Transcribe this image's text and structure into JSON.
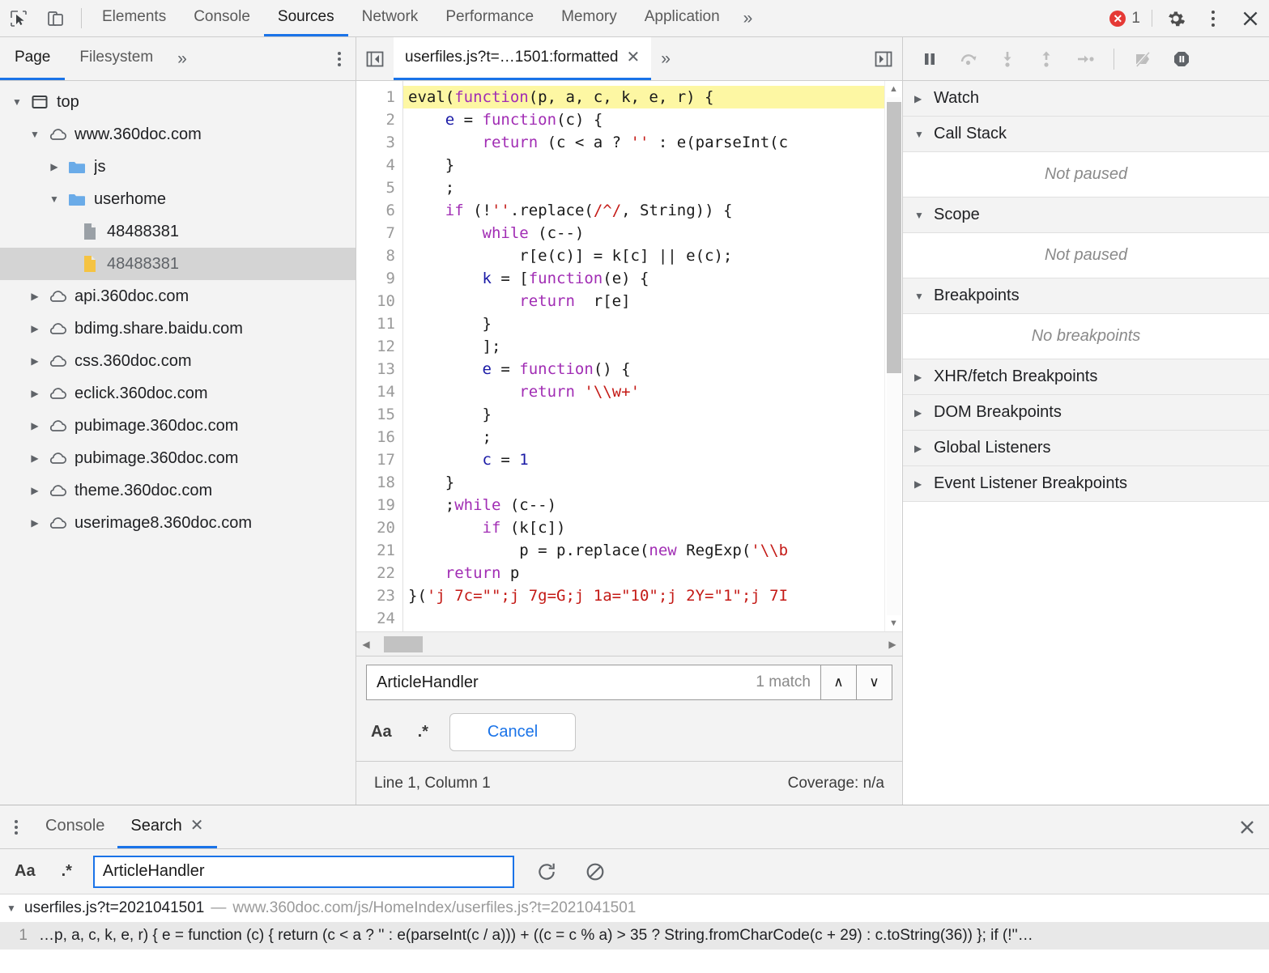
{
  "toolbar": {
    "inspect_icon": "inspect-cursor-icon",
    "device_icon": "device-toolbar-icon",
    "tabs": [
      {
        "label": "Elements",
        "active": false
      },
      {
        "label": "Console",
        "active": false
      },
      {
        "label": "Sources",
        "active": true
      },
      {
        "label": "Network",
        "active": false
      },
      {
        "label": "Performance",
        "active": false
      },
      {
        "label": "Memory",
        "active": false
      },
      {
        "label": "Application",
        "active": false
      }
    ],
    "overflow": "»",
    "error_count": "1",
    "error_glyph": "✕",
    "settings_icon": "gear-icon",
    "menu_icon": "kebab-menu-icon",
    "close_icon": "close-icon"
  },
  "navigator": {
    "tabs": [
      {
        "label": "Page",
        "active": true
      },
      {
        "label": "Filesystem",
        "active": false
      }
    ],
    "overflow": "»",
    "tree": [
      {
        "label": "top",
        "indent": 0,
        "twisty": "down",
        "icon": "frame-icon",
        "selected": false
      },
      {
        "label": "www.360doc.com",
        "indent": 1,
        "twisty": "down",
        "icon": "cloud-icon",
        "selected": false
      },
      {
        "label": "js",
        "indent": 2,
        "twisty": "right",
        "icon": "folder-icon",
        "selected": false
      },
      {
        "label": "userhome",
        "indent": 2,
        "twisty": "down",
        "icon": "folder-icon",
        "selected": false
      },
      {
        "label": "48488381",
        "indent": 3,
        "twisty": "none",
        "icon": "file-gray-icon",
        "selected": false
      },
      {
        "label": "48488381",
        "indent": 3,
        "twisty": "none",
        "icon": "file-yellow-icon",
        "selected": true
      },
      {
        "label": "api.360doc.com",
        "indent": 1,
        "twisty": "right",
        "icon": "cloud-icon",
        "selected": false
      },
      {
        "label": "bdimg.share.baidu.com",
        "indent": 1,
        "twisty": "right",
        "icon": "cloud-icon",
        "selected": false
      },
      {
        "label": "css.360doc.com",
        "indent": 1,
        "twisty": "right",
        "icon": "cloud-icon",
        "selected": false
      },
      {
        "label": "eclick.360doc.com",
        "indent": 1,
        "twisty": "right",
        "icon": "cloud-icon",
        "selected": false
      },
      {
        "label": "pubimage.360doc.com",
        "indent": 1,
        "twisty": "right",
        "icon": "cloud-icon",
        "selected": false
      },
      {
        "label": "pubimage.360doc.com",
        "indent": 1,
        "twisty": "right",
        "icon": "cloud-icon",
        "selected": false
      },
      {
        "label": "theme.360doc.com",
        "indent": 1,
        "twisty": "right",
        "icon": "cloud-icon",
        "selected": false
      },
      {
        "label": "userimage8.360doc.com",
        "indent": 1,
        "twisty": "right",
        "icon": "cloud-icon",
        "selected": false
      }
    ]
  },
  "editor": {
    "nav_back_icon": "panel-collapse-left-icon",
    "nav_forward_icon": "panel-collapse-right-icon",
    "tab_title": "userfiles.js?t=…1501:formatted",
    "tab_close": "✕",
    "tab_overflow": "»",
    "lines": [
      {
        "n": "1",
        "highlight": true,
        "tokens": [
          {
            "t": "eval(",
            "c": "p"
          },
          {
            "t": "function",
            "c": "k"
          },
          {
            "t": "(p, a, c, k, e, r) {",
            "c": "p"
          }
        ]
      },
      {
        "n": "2",
        "highlight": false,
        "tokens": [
          {
            "t": "    ",
            "c": "p"
          },
          {
            "t": "e",
            "c": "v"
          },
          {
            "t": " = ",
            "c": "p"
          },
          {
            "t": "function",
            "c": "k"
          },
          {
            "t": "(c) {",
            "c": "p"
          }
        ]
      },
      {
        "n": "3",
        "highlight": false,
        "tokens": [
          {
            "t": "        ",
            "c": "p"
          },
          {
            "t": "return",
            "c": "k"
          },
          {
            "t": " (c < a ? ",
            "c": "p"
          },
          {
            "t": "''",
            "c": "s"
          },
          {
            "t": " : e(parseInt(c",
            "c": "p"
          }
        ]
      },
      {
        "n": "4",
        "highlight": false,
        "tokens": [
          {
            "t": "    }",
            "c": "p"
          }
        ]
      },
      {
        "n": "5",
        "highlight": false,
        "tokens": [
          {
            "t": "    ;",
            "c": "p"
          }
        ]
      },
      {
        "n": "6",
        "highlight": false,
        "tokens": [
          {
            "t": "    ",
            "c": "p"
          },
          {
            "t": "if",
            "c": "k"
          },
          {
            "t": " (!",
            "c": "p"
          },
          {
            "t": "''",
            "c": "s"
          },
          {
            "t": ".replace(",
            "c": "p"
          },
          {
            "t": "/^/",
            "c": "s"
          },
          {
            "t": ", String)) {",
            "c": "p"
          }
        ]
      },
      {
        "n": "7",
        "highlight": false,
        "tokens": [
          {
            "t": "        ",
            "c": "p"
          },
          {
            "t": "while",
            "c": "k"
          },
          {
            "t": " (c--)",
            "c": "p"
          }
        ]
      },
      {
        "n": "8",
        "highlight": false,
        "tokens": [
          {
            "t": "            r[e(c)] = k[c] || e(c);",
            "c": "p"
          }
        ]
      },
      {
        "n": "9",
        "highlight": false,
        "tokens": [
          {
            "t": "        ",
            "c": "p"
          },
          {
            "t": "k",
            "c": "v"
          },
          {
            "t": " = [",
            "c": "p"
          },
          {
            "t": "function",
            "c": "k"
          },
          {
            "t": "(e) {",
            "c": "p"
          }
        ]
      },
      {
        "n": "10",
        "highlight": false,
        "tokens": [
          {
            "t": "            ",
            "c": "p"
          },
          {
            "t": "return",
            "c": "k"
          },
          {
            "t": "  r[e]",
            "c": "p"
          }
        ]
      },
      {
        "n": "11",
        "highlight": false,
        "tokens": [
          {
            "t": "        }",
            "c": "p"
          }
        ]
      },
      {
        "n": "12",
        "highlight": false,
        "tokens": [
          {
            "t": "        ];",
            "c": "p"
          }
        ]
      },
      {
        "n": "13",
        "highlight": false,
        "tokens": [
          {
            "t": "        ",
            "c": "p"
          },
          {
            "t": "e",
            "c": "v"
          },
          {
            "t": " = ",
            "c": "p"
          },
          {
            "t": "function",
            "c": "k"
          },
          {
            "t": "() {",
            "c": "p"
          }
        ]
      },
      {
        "n": "14",
        "highlight": false,
        "tokens": [
          {
            "t": "            ",
            "c": "p"
          },
          {
            "t": "return",
            "c": "k"
          },
          {
            "t": " ",
            "c": "p"
          },
          {
            "t": "'\\\\w+'",
            "c": "s"
          }
        ]
      },
      {
        "n": "15",
        "highlight": false,
        "tokens": [
          {
            "t": "        }",
            "c": "p"
          }
        ]
      },
      {
        "n": "16",
        "highlight": false,
        "tokens": [
          {
            "t": "        ;",
            "c": "p"
          }
        ]
      },
      {
        "n": "17",
        "highlight": false,
        "tokens": [
          {
            "t": "        ",
            "c": "p"
          },
          {
            "t": "c",
            "c": "v"
          },
          {
            "t": " = ",
            "c": "p"
          },
          {
            "t": "1",
            "c": "v"
          }
        ]
      },
      {
        "n": "18",
        "highlight": false,
        "tokens": [
          {
            "t": "    }",
            "c": "p"
          }
        ]
      },
      {
        "n": "19",
        "highlight": false,
        "tokens": [
          {
            "t": "    ;",
            "c": "p"
          },
          {
            "t": "while",
            "c": "k"
          },
          {
            "t": " (c--)",
            "c": "p"
          }
        ]
      },
      {
        "n": "20",
        "highlight": false,
        "tokens": [
          {
            "t": "        ",
            "c": "p"
          },
          {
            "t": "if",
            "c": "k"
          },
          {
            "t": " (k[c])",
            "c": "p"
          }
        ]
      },
      {
        "n": "21",
        "highlight": false,
        "tokens": [
          {
            "t": "            p = p.replace(",
            "c": "p"
          },
          {
            "t": "new",
            "c": "k"
          },
          {
            "t": " RegExp(",
            "c": "p"
          },
          {
            "t": "'\\\\b",
            "c": "s"
          }
        ]
      },
      {
        "n": "22",
        "highlight": false,
        "tokens": [
          {
            "t": "    ",
            "c": "p"
          },
          {
            "t": "return",
            "c": "k"
          },
          {
            "t": " p",
            "c": "p"
          }
        ]
      },
      {
        "n": "23",
        "highlight": false,
        "tokens": [
          {
            "t": "}(",
            "c": "p"
          },
          {
            "t": "'j 7c=\"\";j 7g=G;j 1a=\"10\";j 2Y=\"1\";j 7I",
            "c": "s"
          }
        ]
      },
      {
        "n": "24",
        "highlight": false,
        "tokens": [
          {
            "t": "",
            "c": "p"
          }
        ]
      }
    ],
    "find": {
      "value": "ArticleHandler",
      "placeholder": "Find",
      "match_count": "1 match",
      "prev_icon": "∧",
      "next_icon": "∨",
      "match_case_label": "Aa",
      "regex_label": ".*",
      "cancel_label": "Cancel"
    },
    "status": {
      "position": "Line 1, Column 1",
      "coverage": "Coverage: n/a"
    }
  },
  "debugger": {
    "controls": [
      {
        "name": "resume-button",
        "icon": "pause-resume-icon"
      },
      {
        "name": "step-over-button",
        "icon": "step-over-icon"
      },
      {
        "name": "step-into-button",
        "icon": "step-into-icon"
      },
      {
        "name": "step-out-button",
        "icon": "step-out-icon"
      },
      {
        "name": "step-button",
        "icon": "step-icon"
      },
      {
        "name": "deactivate-breakpoints-button",
        "icon": "deactivate-breakpoints-icon"
      },
      {
        "name": "pause-on-exceptions-button",
        "icon": "pause-on-exceptions-icon"
      }
    ],
    "sections": [
      {
        "title": "Watch",
        "expanded": false,
        "body": null
      },
      {
        "title": "Call Stack",
        "expanded": true,
        "body": "Not paused"
      },
      {
        "title": "Scope",
        "expanded": true,
        "body": "Not paused"
      },
      {
        "title": "Breakpoints",
        "expanded": true,
        "body": "No breakpoints"
      },
      {
        "title": "XHR/fetch Breakpoints",
        "expanded": false,
        "body": null
      },
      {
        "title": "DOM Breakpoints",
        "expanded": false,
        "body": null
      },
      {
        "title": "Global Listeners",
        "expanded": false,
        "body": null
      },
      {
        "title": "Event Listener Breakpoints",
        "expanded": false,
        "body": null
      }
    ]
  },
  "drawer": {
    "menu_icon": "kebab-menu-icon",
    "tabs": [
      {
        "label": "Console",
        "active": false,
        "closable": false
      },
      {
        "label": "Search",
        "active": true,
        "closable": true
      }
    ],
    "tab_close": "✕",
    "close_icon": "close-icon",
    "search": {
      "match_case_label": "Aa",
      "regex_label": ".*",
      "value": "ArticleHandler",
      "placeholder": "Search",
      "refresh_icon": "refresh-icon",
      "clear_icon": "clear-icon"
    },
    "results": {
      "file_name": "userfiles.js?t=2021041501",
      "separator": "—",
      "file_url": "www.360doc.com/js/HomeIndex/userfiles.js?t=2021041501",
      "expanded": true,
      "matches": [
        {
          "line": "1",
          "text": "…p, a, c, k, e, r) { e = function (c) { return (c < a ? '' : e(parseInt(c / a))) + ((c = c % a) > 35 ? String.fromCharCode(c + 29) : c.toString(36)) }; if (!''…"
        }
      ]
    }
  }
}
